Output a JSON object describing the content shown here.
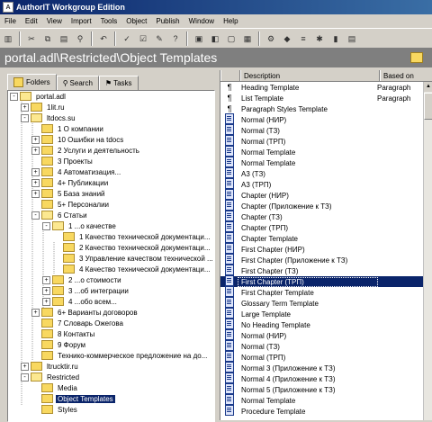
{
  "window": {
    "title": "AuthorIT Workgroup Edition"
  },
  "menu": [
    "File",
    "Edit",
    "View",
    "Import",
    "Tools",
    "Object",
    "Publish",
    "Window",
    "Help"
  ],
  "toolbar": {
    "icons": [
      "library-icon",
      "cut-icon",
      "copy-icon",
      "paste-icon",
      "find-icon",
      "undo-icon",
      "spell-check-icon",
      "check-icon",
      "pencil-icon",
      "whats-this-icon",
      "new-topic-icon",
      "new-book-icon",
      "new-file-icon",
      "new-folder-icon",
      "publish-icon",
      "object-icon",
      "compare-icon",
      "release-icon",
      "stamp-icon",
      "properties-icon"
    ]
  },
  "path": {
    "text": "portal.adl\\Restricted\\Object Templates"
  },
  "tabs": [
    {
      "label": "Folders",
      "icon": "folder-icon"
    },
    {
      "label": "Search",
      "icon": "search-icon"
    },
    {
      "label": "Tasks",
      "icon": "tasks-icon"
    }
  ],
  "tree": [
    {
      "label": "portal.adl",
      "expander": "-"
    },
    {
      "label": "1lit.ru",
      "expander": "+"
    },
    {
      "label": "ltdocs.su",
      "expander": "-"
    },
    {
      "label": "1 О компании",
      "expander": ""
    },
    {
      "label": "10 Ошибки на tdocs",
      "expander": "+"
    },
    {
      "label": "2 Услуги и деятельность",
      "expander": "+"
    },
    {
      "label": "3 Проекты",
      "expander": ""
    },
    {
      "label": "4 Автоматизация...",
      "expander": "+"
    },
    {
      "label": "4+ Публикации",
      "expander": "+"
    },
    {
      "label": "5 База знаний",
      "expander": "+"
    },
    {
      "label": "5+ Персоналии",
      "expander": ""
    },
    {
      "label": "6 Статьи",
      "expander": "-"
    },
    {
      "label": "1 ...о качестве",
      "expander": "-"
    },
    {
      "label": "1 Качество технической документаци...",
      "expander": ""
    },
    {
      "label": "2 Качество технической документаци...",
      "expander": ""
    },
    {
      "label": "3 Управление качеством технической ...",
      "expander": ""
    },
    {
      "label": "4 Качество технической документаци...",
      "expander": ""
    },
    {
      "label": "2 ...о стоимости",
      "expander": "+"
    },
    {
      "label": "3 ...об интеграции",
      "expander": "+"
    },
    {
      "label": "4 ...обо всем...",
      "expander": "+"
    },
    {
      "label": "6+ Варианты договоров",
      "expander": "+"
    },
    {
      "label": "7 Словарь Ожегова",
      "expander": ""
    },
    {
      "label": "8 Контакты",
      "expander": ""
    },
    {
      "label": "9 Форум",
      "expander": ""
    },
    {
      "label": "Техникo-коммерческое предложение на до...",
      "expander": ""
    },
    {
      "label": "ltrucktir.ru",
      "expander": "+"
    },
    {
      "label": "Restricted",
      "expander": "-"
    },
    {
      "label": "Media",
      "expander": ""
    },
    {
      "label": "Object Templates",
      "expander": ""
    },
    {
      "label": "Styles",
      "expander": ""
    }
  ],
  "list": {
    "columns": [
      "Description",
      "Based on"
    ],
    "rows": [
      {
        "icon": "paragraph-icon",
        "desc": "Heading Template",
        "base": "Paragraph"
      },
      {
        "icon": "paragraph-icon",
        "desc": "List Template",
        "base": "Paragraph"
      },
      {
        "icon": "paragraph-icon",
        "desc": "Paragraph Styles Template",
        "base": ""
      },
      {
        "icon": "page-icon",
        "desc": "Normal (НИР)",
        "base": ""
      },
      {
        "icon": "page-icon",
        "desc": "Normal (ТЗ)",
        "base": ""
      },
      {
        "icon": "page-icon",
        "desc": "Normal (ТРП)",
        "base": ""
      },
      {
        "icon": "page-icon",
        "desc": "Normal Template",
        "base": ""
      },
      {
        "icon": "page-icon",
        "desc": "Normal Template",
        "base": ""
      },
      {
        "icon": "page-icon",
        "desc": "А3 (ТЗ)",
        "base": ""
      },
      {
        "icon": "page-icon",
        "desc": "А3 (ТРП)",
        "base": ""
      },
      {
        "icon": "page-icon",
        "desc": "Chapter (НИР)",
        "base": ""
      },
      {
        "icon": "page-icon",
        "desc": "Chapter (Приложение к ТЗ)",
        "base": ""
      },
      {
        "icon": "page-icon",
        "desc": "Chapter (ТЗ)",
        "base": ""
      },
      {
        "icon": "page-icon",
        "desc": "Chapter (ТРП)",
        "base": ""
      },
      {
        "icon": "page-icon",
        "desc": "Chapter Template",
        "base": ""
      },
      {
        "icon": "page-icon",
        "desc": "First Chapter (НИР)",
        "base": ""
      },
      {
        "icon": "page-icon",
        "desc": "First Chapter (Приложение к ТЗ)",
        "base": ""
      },
      {
        "icon": "page-icon",
        "desc": "First Chapter (ТЗ)",
        "base": ""
      },
      {
        "icon": "page-icon",
        "desc": "First Chapter (ТРП)",
        "base": ""
      },
      {
        "icon": "page-icon",
        "desc": "First Chapter Template",
        "base": ""
      },
      {
        "icon": "page-icon",
        "desc": "Glossary Term Template",
        "base": ""
      },
      {
        "icon": "page-icon",
        "desc": "Large Template",
        "base": ""
      },
      {
        "icon": "page-icon",
        "desc": "No Heading Template",
        "base": ""
      },
      {
        "icon": "page-icon",
        "desc": "Normal (НИР)",
        "base": ""
      },
      {
        "icon": "page-icon",
        "desc": "Normal (ТЗ)",
        "base": ""
      },
      {
        "icon": "page-icon",
        "desc": "Normal (ТРП)",
        "base": ""
      },
      {
        "icon": "page-icon",
        "desc": "Normal 3 (Приложение к ТЗ)",
        "base": ""
      },
      {
        "icon": "page-icon",
        "desc": "Normal 4 (Приложение к ТЗ)",
        "base": ""
      },
      {
        "icon": "page-icon",
        "desc": "Normal 5 (Приложение к ТЗ)",
        "base": ""
      },
      {
        "icon": "page-icon",
        "desc": "Normal Template",
        "base": ""
      },
      {
        "icon": "page-icon",
        "desc": "Procedure Template",
        "base": ""
      }
    ]
  },
  "colors": {
    "selection": "#0a246a",
    "pathbar": "#7f7f7f",
    "titlebar": "#0a246a"
  }
}
